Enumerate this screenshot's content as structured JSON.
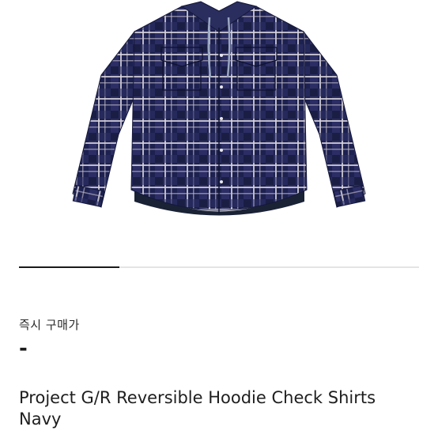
{
  "product": {
    "title": "Project G/R Reversible Hoodie Check Shirts Navy",
    "image_alt": "navy check hoodie shirt",
    "colors": {
      "navy": "#1d2150",
      "stripe_light": "#d9d4dc",
      "stripe_mid": "#3c3f7a",
      "lining": "#1a2235",
      "drawstring": "#9aa7c0"
    }
  },
  "carousel": {
    "active_fraction": 0.25
  },
  "price": {
    "label": "즉시 구매가",
    "value": "-"
  }
}
